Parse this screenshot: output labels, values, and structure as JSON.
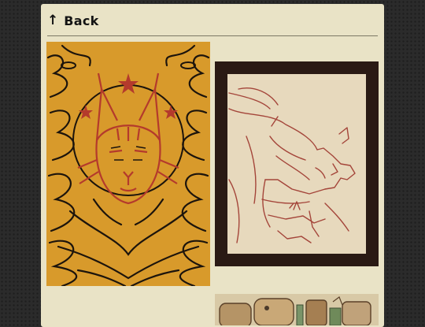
{
  "header": {
    "back_icon": "arrow-up-icon",
    "back_label": "Back"
  },
  "gallery": {
    "items": [
      {
        "subject": "lynx-illustration",
        "palette": [
          "#d89a2b",
          "#1c140c",
          "#b43a2c"
        ]
      },
      {
        "subject": "helmeted-warrior-sketch",
        "palette": [
          "#2a1a14",
          "#e7d9bd",
          "#a4453a"
        ]
      },
      {
        "subject": "painted-still-life",
        "palette": [
          "#d8c9a6",
          "#8a6a3c",
          "#5d7d55"
        ]
      }
    ]
  }
}
